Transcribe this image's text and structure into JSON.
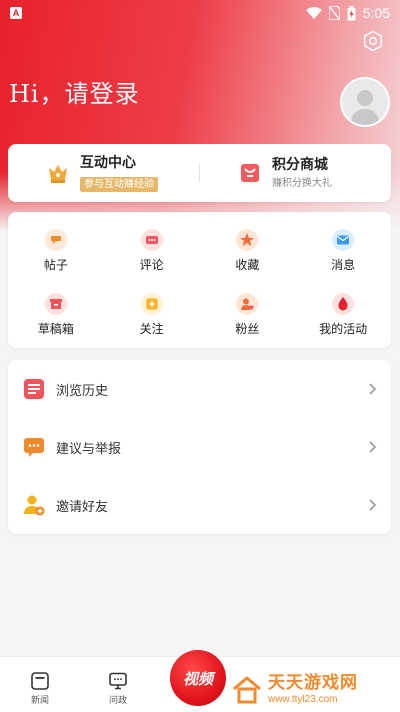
{
  "status_bar": {
    "app_badge": "A",
    "time": "5:05"
  },
  "header": {
    "greeting": "Hi，请登录"
  },
  "promo": [
    {
      "title": "互动中心",
      "subtitle": "参与互动赚经验"
    },
    {
      "title": "积分商城",
      "subtitle": "赚积分换大礼"
    }
  ],
  "grid": [
    {
      "label": "帖子",
      "icon": "post-icon"
    },
    {
      "label": "评论",
      "icon": "comment-icon"
    },
    {
      "label": "收藏",
      "icon": "star-icon"
    },
    {
      "label": "消息",
      "icon": "mail-icon"
    },
    {
      "label": "草稿箱",
      "icon": "draft-box-icon"
    },
    {
      "label": "关注",
      "icon": "follow-icon"
    },
    {
      "label": "粉丝",
      "icon": "fans-icon"
    },
    {
      "label": "我的活动",
      "icon": "activity-icon"
    }
  ],
  "list": [
    {
      "label": "浏览历史",
      "icon": "history-icon"
    },
    {
      "label": "建议与举报",
      "icon": "feedback-icon"
    },
    {
      "label": "邀请好友",
      "icon": "invite-friend-icon"
    }
  ],
  "tabbar": [
    {
      "label": "新闻",
      "icon": "news-icon"
    },
    {
      "label": "问政",
      "icon": "politics-icon"
    }
  ],
  "video_button": {
    "label": "视频"
  },
  "watermark": {
    "title": "天天游戏网",
    "url": "www.ttyl23.com"
  },
  "colors": {
    "brand_red": "#e8212b",
    "accent_orange": "#f08a2c",
    "gold": "#e7b86a"
  }
}
